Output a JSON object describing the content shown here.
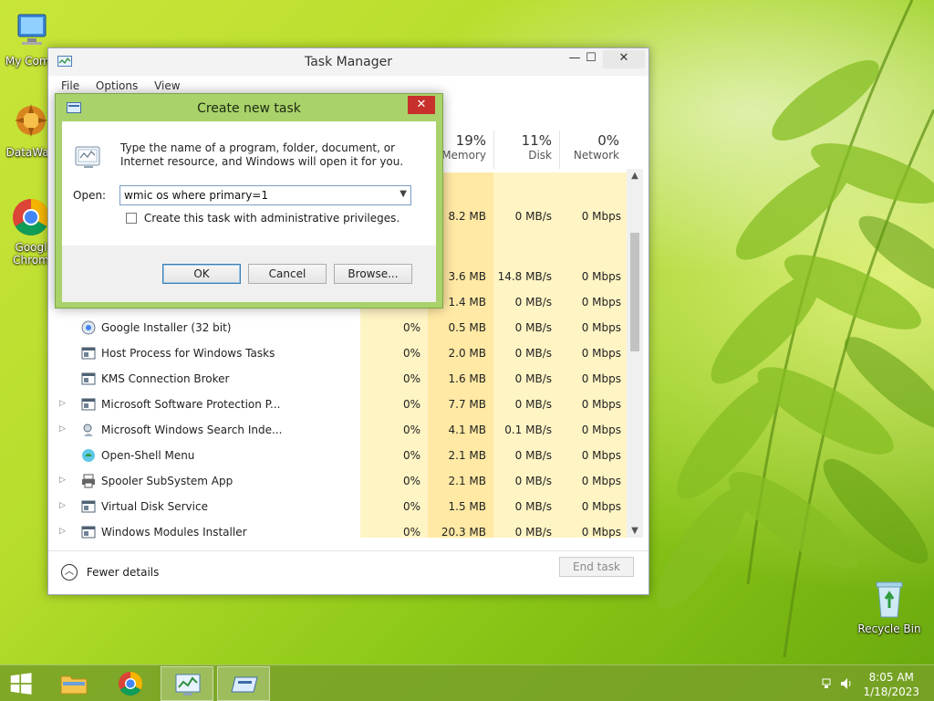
{
  "desktop": {
    "icons": [
      {
        "label": "My Comp"
      },
      {
        "label": "DataWag"
      },
      {
        "label": "Googl Chrom"
      },
      {
        "label": "Recycle Bin"
      }
    ]
  },
  "task_manager": {
    "title": "Task Manager",
    "menu": [
      "File",
      "Options",
      "View"
    ],
    "window_buttons": {
      "minimize": "—",
      "maximize": "☐",
      "close": "✕"
    },
    "columns": [
      {
        "percent": "19%",
        "label": "Memory"
      },
      {
        "percent": "11%",
        "label": "Disk"
      },
      {
        "percent": "0%",
        "label": "Network"
      }
    ],
    "partial_rows": [
      {
        "memory": "8.2 MB",
        "disk": "0 MB/s",
        "network": "0 Mbps"
      },
      {
        "memory": "3.6 MB",
        "disk": "14.8 MB/s",
        "network": "0 Mbps"
      },
      {
        "memory": "1.4 MB",
        "disk": "0 MB/s",
        "network": "0 Mbps"
      }
    ],
    "processes": [
      {
        "name": "Google Installer (32 bit)",
        "cpu": "0%",
        "memory": "0.5 MB",
        "disk": "0 MB/s",
        "network": "0 Mbps",
        "expandable": false,
        "icon": "google-installer-icon"
      },
      {
        "name": "Host Process for Windows Tasks",
        "cpu": "0%",
        "memory": "2.0 MB",
        "disk": "0 MB/s",
        "network": "0 Mbps",
        "expandable": false,
        "icon": "process-window-icon"
      },
      {
        "name": "KMS Connection Broker",
        "cpu": "0%",
        "memory": "1.6 MB",
        "disk": "0 MB/s",
        "network": "0 Mbps",
        "expandable": false,
        "icon": "process-window-icon"
      },
      {
        "name": "Microsoft Software Protection P...",
        "cpu": "0%",
        "memory": "7.7 MB",
        "disk": "0 MB/s",
        "network": "0 Mbps",
        "expandable": true,
        "icon": "process-window-icon"
      },
      {
        "name": "Microsoft Windows Search Inde...",
        "cpu": "0%",
        "memory": "4.1 MB",
        "disk": "0.1 MB/s",
        "network": "0 Mbps",
        "expandable": true,
        "icon": "search-indexer-icon"
      },
      {
        "name": "Open-Shell Menu",
        "cpu": "0%",
        "memory": "2.1 MB",
        "disk": "0 MB/s",
        "network": "0 Mbps",
        "expandable": false,
        "icon": "open-shell-icon"
      },
      {
        "name": "Spooler SubSystem App",
        "cpu": "0%",
        "memory": "2.1 MB",
        "disk": "0 MB/s",
        "network": "0 Mbps",
        "expandable": true,
        "icon": "printer-icon"
      },
      {
        "name": "Virtual Disk Service",
        "cpu": "0%",
        "memory": "1.5 MB",
        "disk": "0 MB/s",
        "network": "0 Mbps",
        "expandable": true,
        "icon": "process-window-icon"
      },
      {
        "name": "Windows Modules Installer",
        "cpu": "0%",
        "memory": "20.3 MB",
        "disk": "0 MB/s",
        "network": "0 Mbps",
        "expandable": true,
        "icon": "process-window-icon"
      }
    ],
    "footer": {
      "fewer_details": "Fewer details",
      "end_task": "End task"
    }
  },
  "dialog": {
    "title": "Create new task",
    "close": "✕",
    "description": "Type the name of a program, folder, document, or Internet resource, and Windows will open it for you.",
    "open_label": "Open:",
    "open_value": "wmic os where primary=1",
    "admin_checkbox_label": "Create this task with administrative privileges.",
    "admin_checked": false,
    "buttons": {
      "ok": "OK",
      "cancel": "Cancel",
      "browse": "Browse..."
    }
  },
  "taskbar": {
    "time": "8:05 AM",
    "date": "1/18/2023"
  },
  "colors": {
    "heat_cpu": "#fff4c4",
    "heat_memory": "#ffe9a4",
    "dialog_frame": "#a9d26a",
    "close_red": "#c7302b"
  }
}
